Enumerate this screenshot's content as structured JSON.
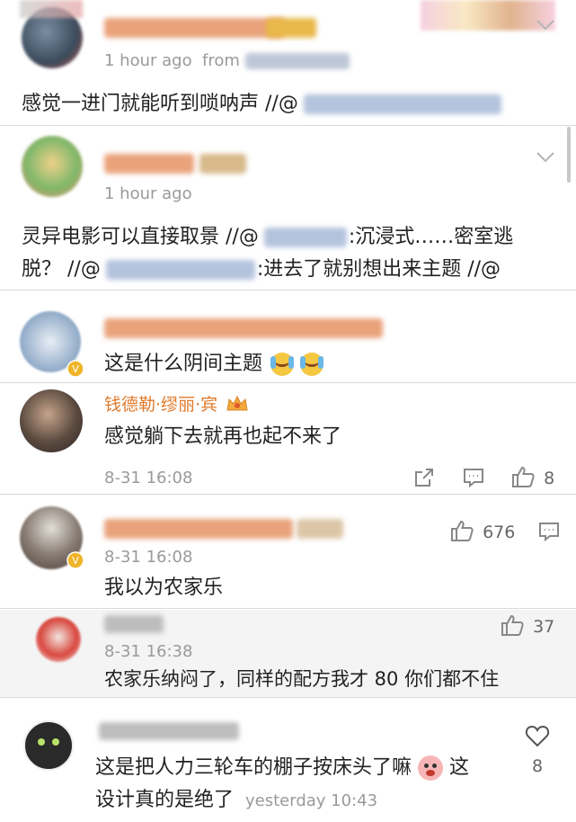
{
  "comments": [
    {
      "time": "1 hour ago",
      "source_prefix": "from",
      "text": "感觉一进门就能听到唢呐声 //@"
    },
    {
      "time": "1 hour ago",
      "text_line1_a": "灵异电影可以直接取景 //@",
      "text_line1_b": ":沉浸式……密室逃",
      "text_line2_a": "脱？ //@",
      "text_line2_b": ":进去了就别想出来主题 //@"
    },
    {
      "text": "这是什么阴间主题"
    },
    {
      "username": "钱德勒·缪丽·宾",
      "text": "感觉躺下去就再也起不来了",
      "time": "8-31 16:08",
      "like_count": "8"
    },
    {
      "time": "8-31 16:08",
      "text": "我以为农家乐",
      "like_count": "676"
    },
    {
      "time": "8-31 16:38",
      "text": "农家乐纳闷了，同样的配方我才 80 你们都不住",
      "like_count": "37"
    },
    {
      "text_line1": "这是把人力三轮车的棚子按床头了嘛",
      "text_line1_end": "这",
      "text_line2": "设计真的是绝了",
      "time": "yesterday 10:43",
      "like_count": "8"
    }
  ],
  "colors": {
    "username_orange": "#e07a2b",
    "mention_blue": "#5a7fbf",
    "meta_gray": "#9a9a9a",
    "divider": "#d8d8d8"
  },
  "icons": [
    "chevron-down-icon",
    "share-icon",
    "comment-icon",
    "thumbs-up-icon",
    "heart-icon",
    "crying-laughing-emoji",
    "crown-badge-icon",
    "verified-badge-icon"
  ]
}
